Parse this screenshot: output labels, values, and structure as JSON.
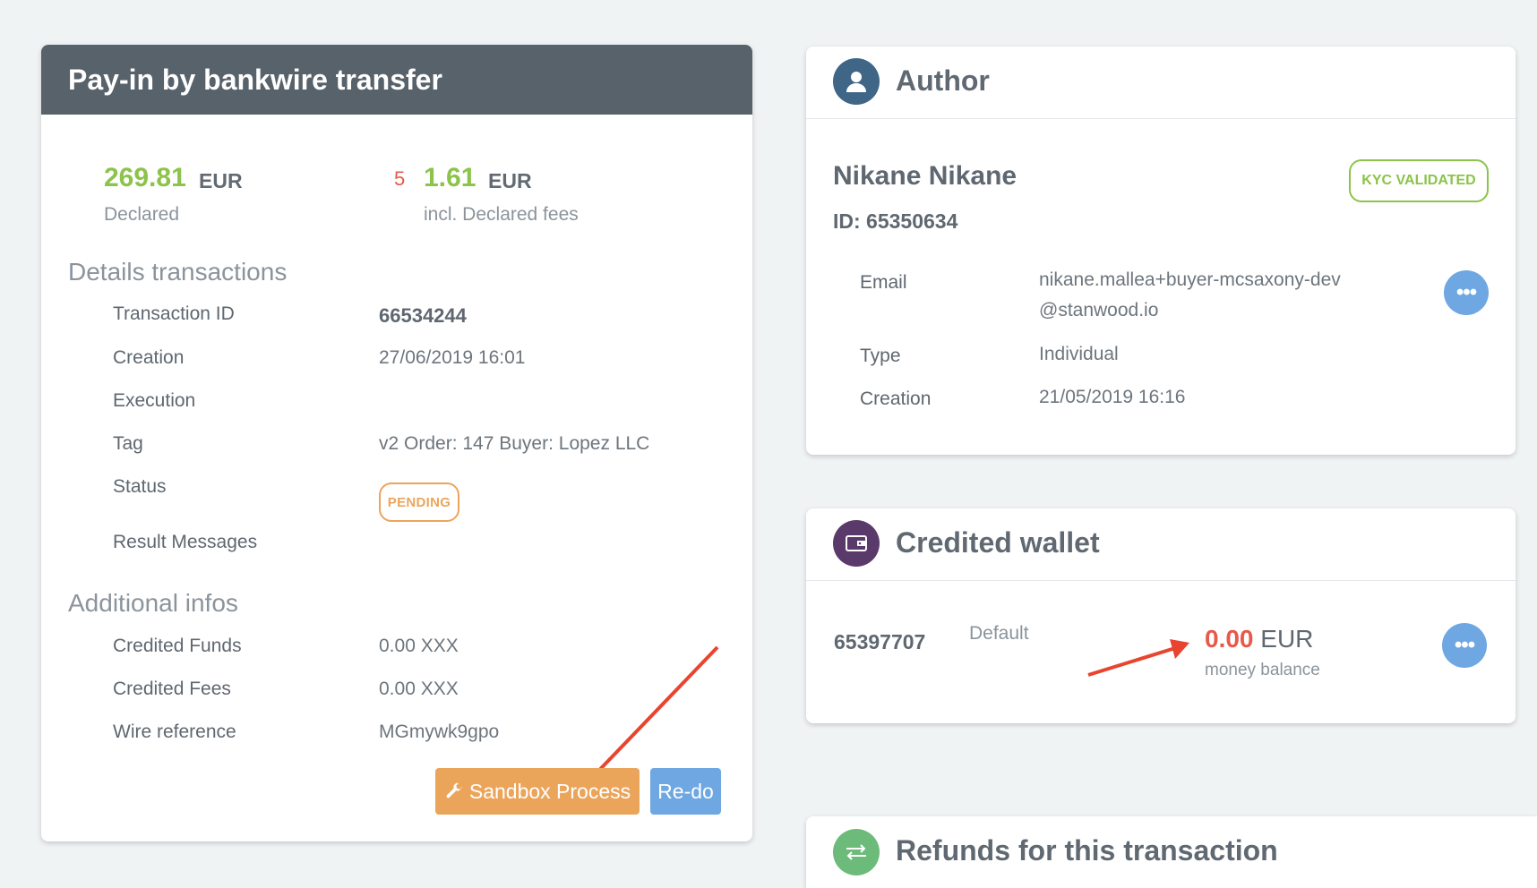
{
  "payin": {
    "title": "Pay-in by bankwire transfer",
    "declared_amount": "269.81",
    "declared_currency": "EUR",
    "declared_label": "Declared",
    "fees_count": "5",
    "fees_amount": "1.61",
    "fees_currency": "EUR",
    "fees_label": "incl. Declared fees",
    "details_heading": "Details transactions",
    "details": [
      {
        "label": "Transaction ID",
        "value": "66534244"
      },
      {
        "label": "Creation",
        "value": "27/06/2019 16:01"
      },
      {
        "label": "Execution",
        "value": ""
      },
      {
        "label": "Tag",
        "value": "v2 Order: 147 Buyer: Lopez LLC"
      },
      {
        "label": "Status",
        "value": "PENDING"
      },
      {
        "label": "Result Messages",
        "value": ""
      }
    ],
    "additional_heading": "Additional infos",
    "additional": [
      {
        "label": "Credited Funds",
        "value": "0.00 XXX"
      },
      {
        "label": "Credited Fees",
        "value": "0.00 XXX"
      },
      {
        "label": "Wire reference",
        "value": "MGmywk9gpo"
      }
    ],
    "sandbox_button": "Sandbox Process",
    "redo_button": "Re-do"
  },
  "author": {
    "title": "Author",
    "name": "Nikane Nikane",
    "id_line": "ID: 65350634",
    "kyc_badge": "KYC VALIDATED",
    "rows": [
      {
        "label": "Email",
        "value": "nikane.mallea+buyer-mcsaxony-dev@stanwood.io"
      },
      {
        "label": "Type",
        "value": "Individual"
      },
      {
        "label": "Creation",
        "value": "21/05/2019 16:16"
      }
    ],
    "more_button": "•••"
  },
  "wallet": {
    "title": "Credited wallet",
    "id": "65397707",
    "tag": "Default",
    "balance": "0.00",
    "currency": "EUR",
    "balance_label": "money balance",
    "more_button": "•••"
  },
  "refunds": {
    "title": "Refunds for this transaction"
  },
  "colors": {
    "header_dark": "#58626b",
    "green": "#8cc34b",
    "orange": "#eba55b",
    "blue": "#6ea7e2",
    "red": "#e65a4a",
    "author_icon": "#3f6587",
    "wallet_icon": "#5a3a6a",
    "refunds_icon": "#6dbb7a"
  }
}
